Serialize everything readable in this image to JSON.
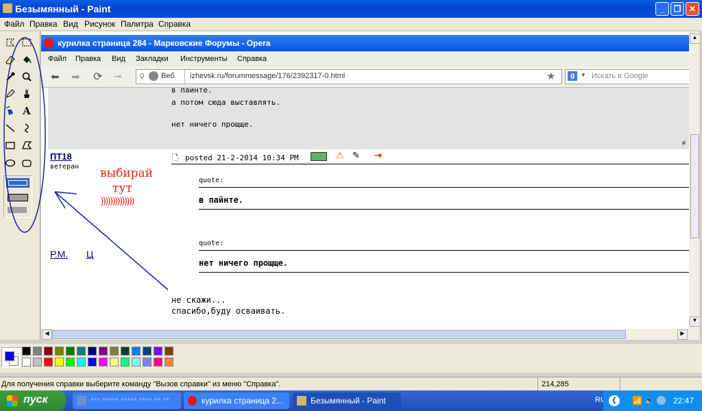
{
  "paint": {
    "title": "Безымянный - Paint",
    "menu": [
      "Файл",
      "Правка",
      "Вид",
      "Рисунок",
      "Палитра",
      "Справка"
    ],
    "status_text": "Для получения справки выберите команду \"Вызов справки\" из меню \"Справка\".",
    "coords": "214,285"
  },
  "opera": {
    "title": "курилка страница 284 - Марковские Форумы - Opera",
    "menu": [
      "Файл",
      "Правка",
      "Вид",
      "Закладки",
      "Инструменты",
      "Справка"
    ],
    "web_label": "Веб",
    "url": "izhevsk.ru/forummessage/176/2392317-0.html",
    "search_placeholder": "Искать в Google"
  },
  "post_prev": {
    "lines": [
      "в пайнте.",
      "а потом сюда выставлять.",
      "нет ничего прощще."
    ],
    "hash": "#"
  },
  "post": {
    "author": "ПТ18",
    "rank": "ветеран",
    "meta": "posted 21-2-2014 10:34 PM",
    "quote_label": "quote:",
    "quote1": "в пайнте.",
    "quote2": "нет ничего прощще.",
    "links": [
      "Р.М.",
      "Ц"
    ],
    "reply": [
      "не скажи...",
      "спасибо,буду осваивать."
    ]
  },
  "annotation": {
    "line1": "выбирай",
    "line2": "тут",
    "line3": "))))))))))))))"
  },
  "taskbar": {
    "start": "пуск",
    "tasks": [
      "*** ***** ***** **** ** **",
      "курилка страница 2...",
      "Безымянный - Paint"
    ],
    "lang": "RU",
    "time": "22:47"
  },
  "colors": {
    "primary": "#0000ff",
    "secondary": "#ffffff",
    "palette_row1": [
      "#000000",
      "#808080",
      "#800000",
      "#808000",
      "#008000",
      "#008080",
      "#000080",
      "#800080",
      "#808040",
      "#004040",
      "#0080ff",
      "#004080",
      "#8000ff",
      "#804000"
    ],
    "palette_row2": [
      "#ffffff",
      "#c0c0c0",
      "#ff0000",
      "#ffff00",
      "#00ff00",
      "#00ffff",
      "#0000ff",
      "#ff00ff",
      "#ffff80",
      "#00ff80",
      "#80ffff",
      "#8080ff",
      "#ff0080",
      "#ff8040"
    ]
  }
}
